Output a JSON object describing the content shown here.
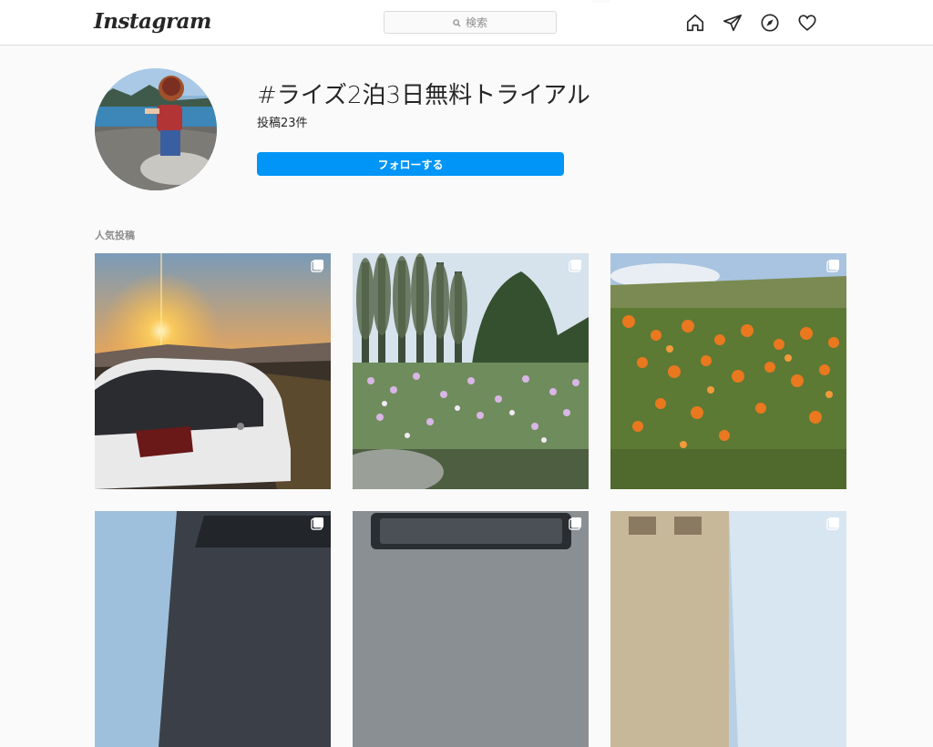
{
  "nav": {
    "logo": "Instagram",
    "search_placeholder": "検索",
    "icons": [
      "home-icon",
      "direct-icon",
      "explore-icon",
      "activity-icon"
    ]
  },
  "hashtag": {
    "title": "#ライズ2泊3日無料トライアル",
    "post_count": "投稿23件",
    "follow_label": "フォローする"
  },
  "section": {
    "top_posts_label": "人気投稿"
  },
  "colors": {
    "accent": "#0095f6",
    "border": "#dbdbdb",
    "background": "#fafafa"
  }
}
